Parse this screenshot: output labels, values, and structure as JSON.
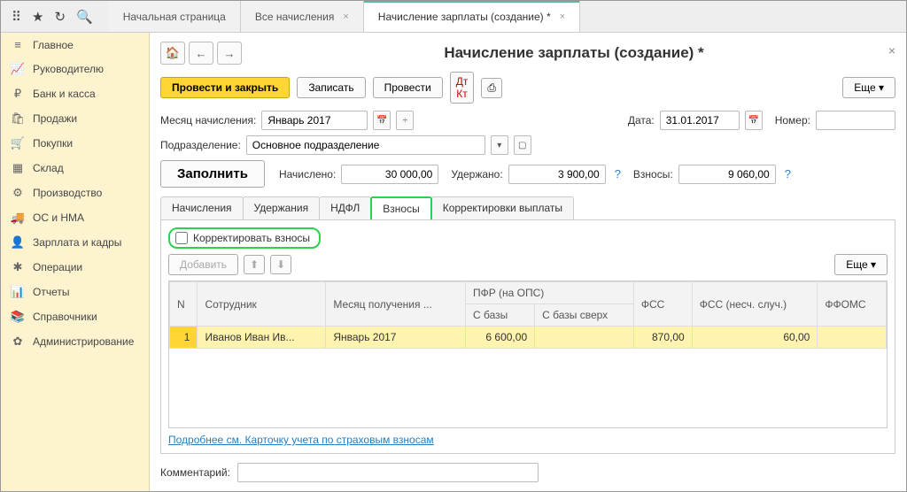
{
  "top_tabs": {
    "t0": "Начальная страница",
    "t1": "Все начисления",
    "t2": "Начисление зарплаты (создание) *"
  },
  "sidebar": {
    "items": [
      {
        "icon": "≡",
        "label": "Главное"
      },
      {
        "icon": "📈",
        "label": "Руководителю"
      },
      {
        "icon": "₽",
        "label": "Банк и касса"
      },
      {
        "icon": "🛍",
        "label": "Продажи"
      },
      {
        "icon": "🛒",
        "label": "Покупки"
      },
      {
        "icon": "▦",
        "label": "Склад"
      },
      {
        "icon": "⚙",
        "label": "Производство"
      },
      {
        "icon": "🚚",
        "label": "ОС и НМА"
      },
      {
        "icon": "👤",
        "label": "Зарплата и кадры"
      },
      {
        "icon": "✱",
        "label": "Операции"
      },
      {
        "icon": "📊",
        "label": "Отчеты"
      },
      {
        "icon": "📚",
        "label": "Справочники"
      },
      {
        "icon": "✿",
        "label": "Администрирование"
      }
    ]
  },
  "page": {
    "title": "Начисление зарплаты (создание) *",
    "buttons": {
      "post_close": "Провести и закрыть",
      "write": "Записать",
      "post": "Провести",
      "more": "Еще ▾"
    },
    "fields": {
      "month_label": "Месяц начисления:",
      "month_value": "Январь 2017",
      "date_label": "Дата:",
      "date_value": "31.01.2017",
      "number_label": "Номер:",
      "number_value": "",
      "dept_label": "Подразделение:",
      "dept_value": "Основное подразделение",
      "fill_btn": "Заполнить",
      "accrued_label": "Начислено:",
      "accrued_value": "30 000,00",
      "withheld_label": "Удержано:",
      "withheld_value": "3 900,00",
      "contrib_label": "Взносы:",
      "contrib_value": "9 060,00"
    },
    "tabs": {
      "t0": "Начисления",
      "t1": "Удержания",
      "t2": "НДФЛ",
      "t3": "Взносы",
      "t4": "Корректировки выплаты"
    },
    "contrib_tab": {
      "checkbox_label": "Корректировать взносы",
      "add_btn": "Добавить",
      "more_btn": "Еще ▾",
      "headers": {
        "n": "N",
        "emp": "Сотрудник",
        "month": "Месяц получения ...",
        "pfr": "ПФР (на ОПС)",
        "pfr1": "С базы",
        "pfr2": "С базы сверх",
        "fss": "ФСС",
        "fss_ns": "ФСС (несч. случ.)",
        "ffoms": "ФФОМС"
      },
      "row": {
        "n": "1",
        "emp": "Иванов Иван Ив...",
        "month": "Январь 2017",
        "pfr1": "6 600,00",
        "pfr2": "",
        "fss": "870,00",
        "fss_ns": "60,00",
        "ffoms": ""
      }
    },
    "link": "Подробнее см. Карточку учета по страховым взносам",
    "comment_label": "Комментарий:"
  }
}
